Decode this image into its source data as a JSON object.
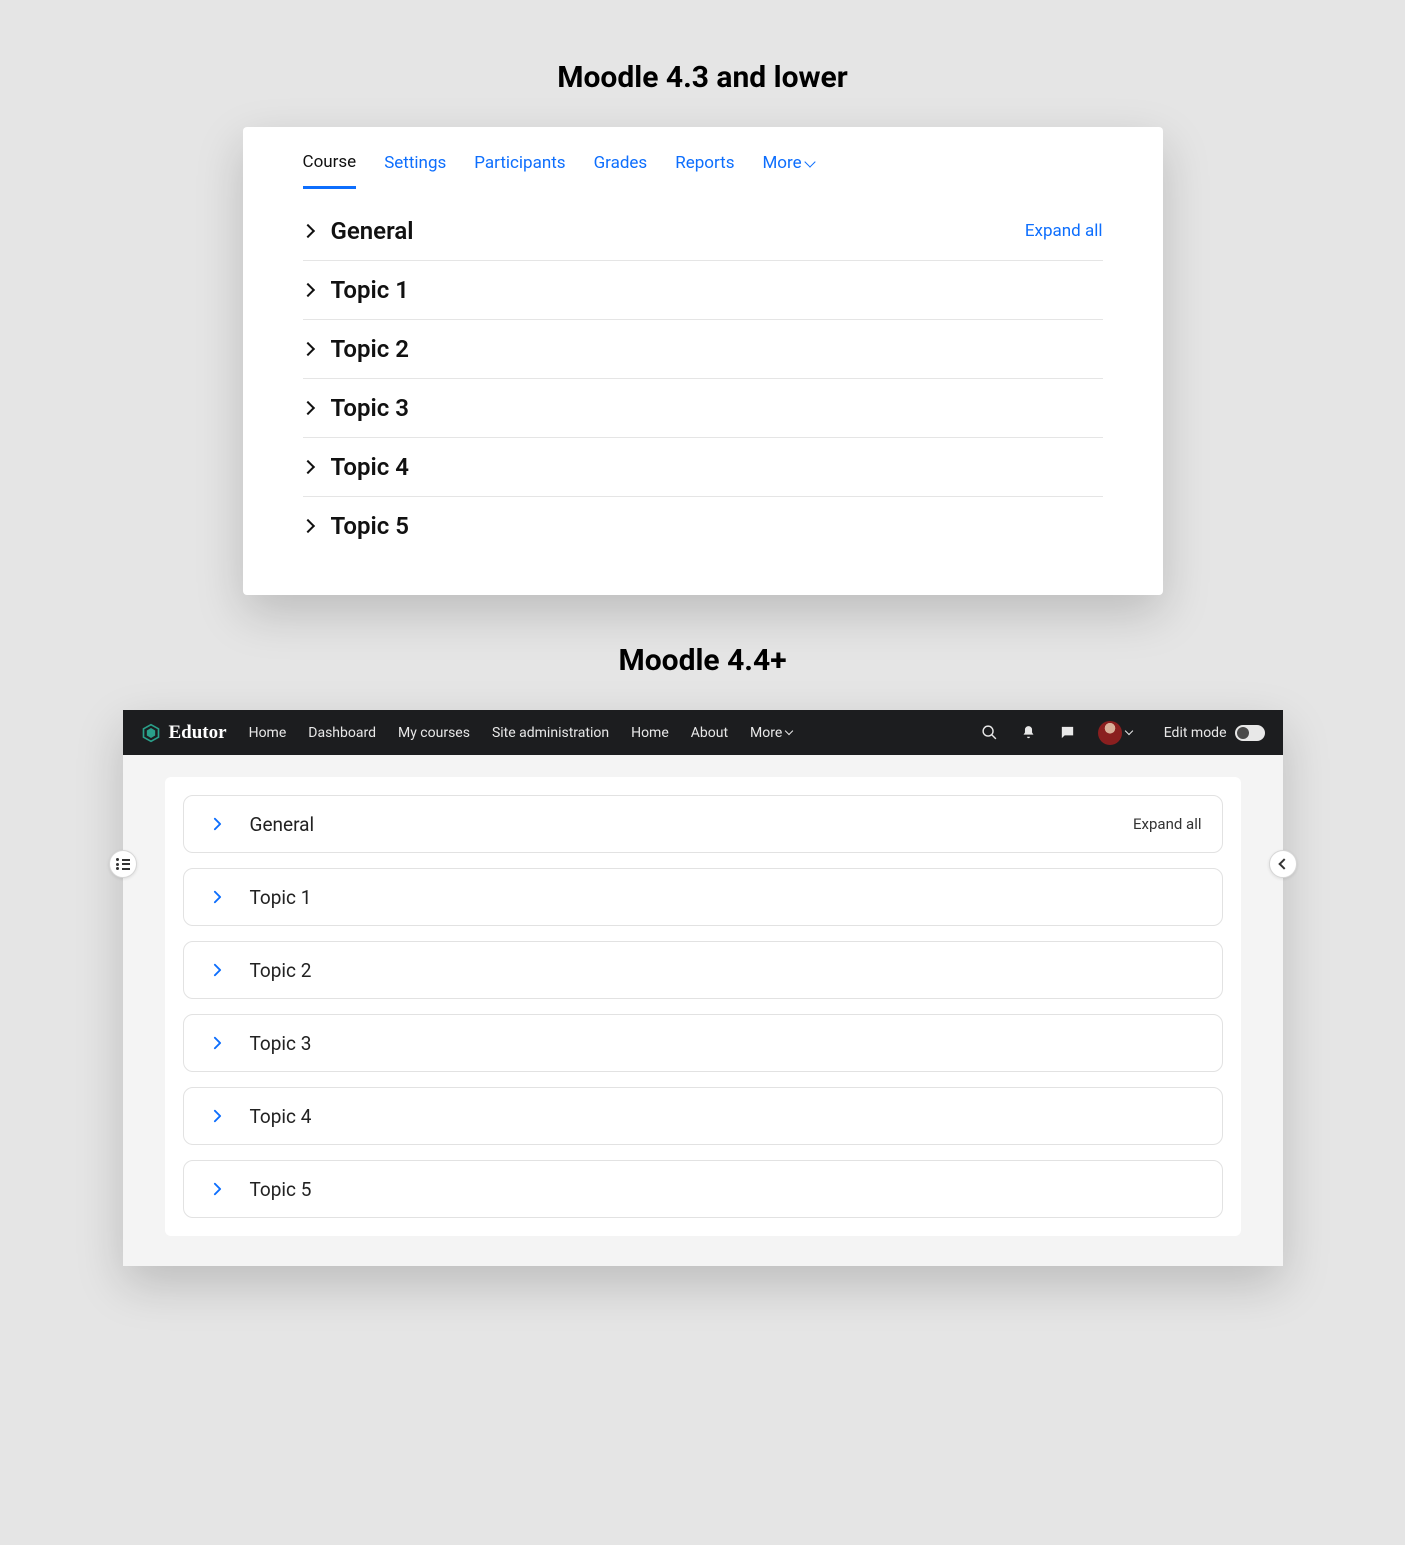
{
  "headings": {
    "panel43": "Moodle 4.3 and lower",
    "panel44": "Moodle 4.4+"
  },
  "panel43": {
    "tabs": [
      {
        "label": "Course",
        "active": true
      },
      {
        "label": "Settings",
        "active": false
      },
      {
        "label": "Participants",
        "active": false
      },
      {
        "label": "Grades",
        "active": false
      },
      {
        "label": "Reports",
        "active": false
      },
      {
        "label": "More",
        "active": false,
        "dropdown": true
      }
    ],
    "expand_all": "Expand all",
    "sections": [
      {
        "title": "General"
      },
      {
        "title": "Topic 1"
      },
      {
        "title": "Topic 2"
      },
      {
        "title": "Topic 3"
      },
      {
        "title": "Topic 4"
      },
      {
        "title": "Topic 5"
      }
    ]
  },
  "panel44": {
    "brand": "Edutor",
    "nav": [
      {
        "label": "Home"
      },
      {
        "label": "Dashboard"
      },
      {
        "label": "My courses"
      },
      {
        "label": "Site administration"
      },
      {
        "label": "Home"
      },
      {
        "label": "About"
      },
      {
        "label": "More",
        "dropdown": true
      }
    ],
    "edit_mode_label": "Edit mode",
    "expand_all": "Expand all",
    "sections": [
      {
        "title": "General"
      },
      {
        "title": "Topic 1"
      },
      {
        "title": "Topic 2"
      },
      {
        "title": "Topic 3"
      },
      {
        "title": "Topic 4"
      },
      {
        "title": "Topic 5"
      }
    ]
  },
  "colors": {
    "link_blue": "#0d6efd",
    "card_chevron_blue": "#0d6efd",
    "navbar_bg": "#1c1d1f"
  }
}
